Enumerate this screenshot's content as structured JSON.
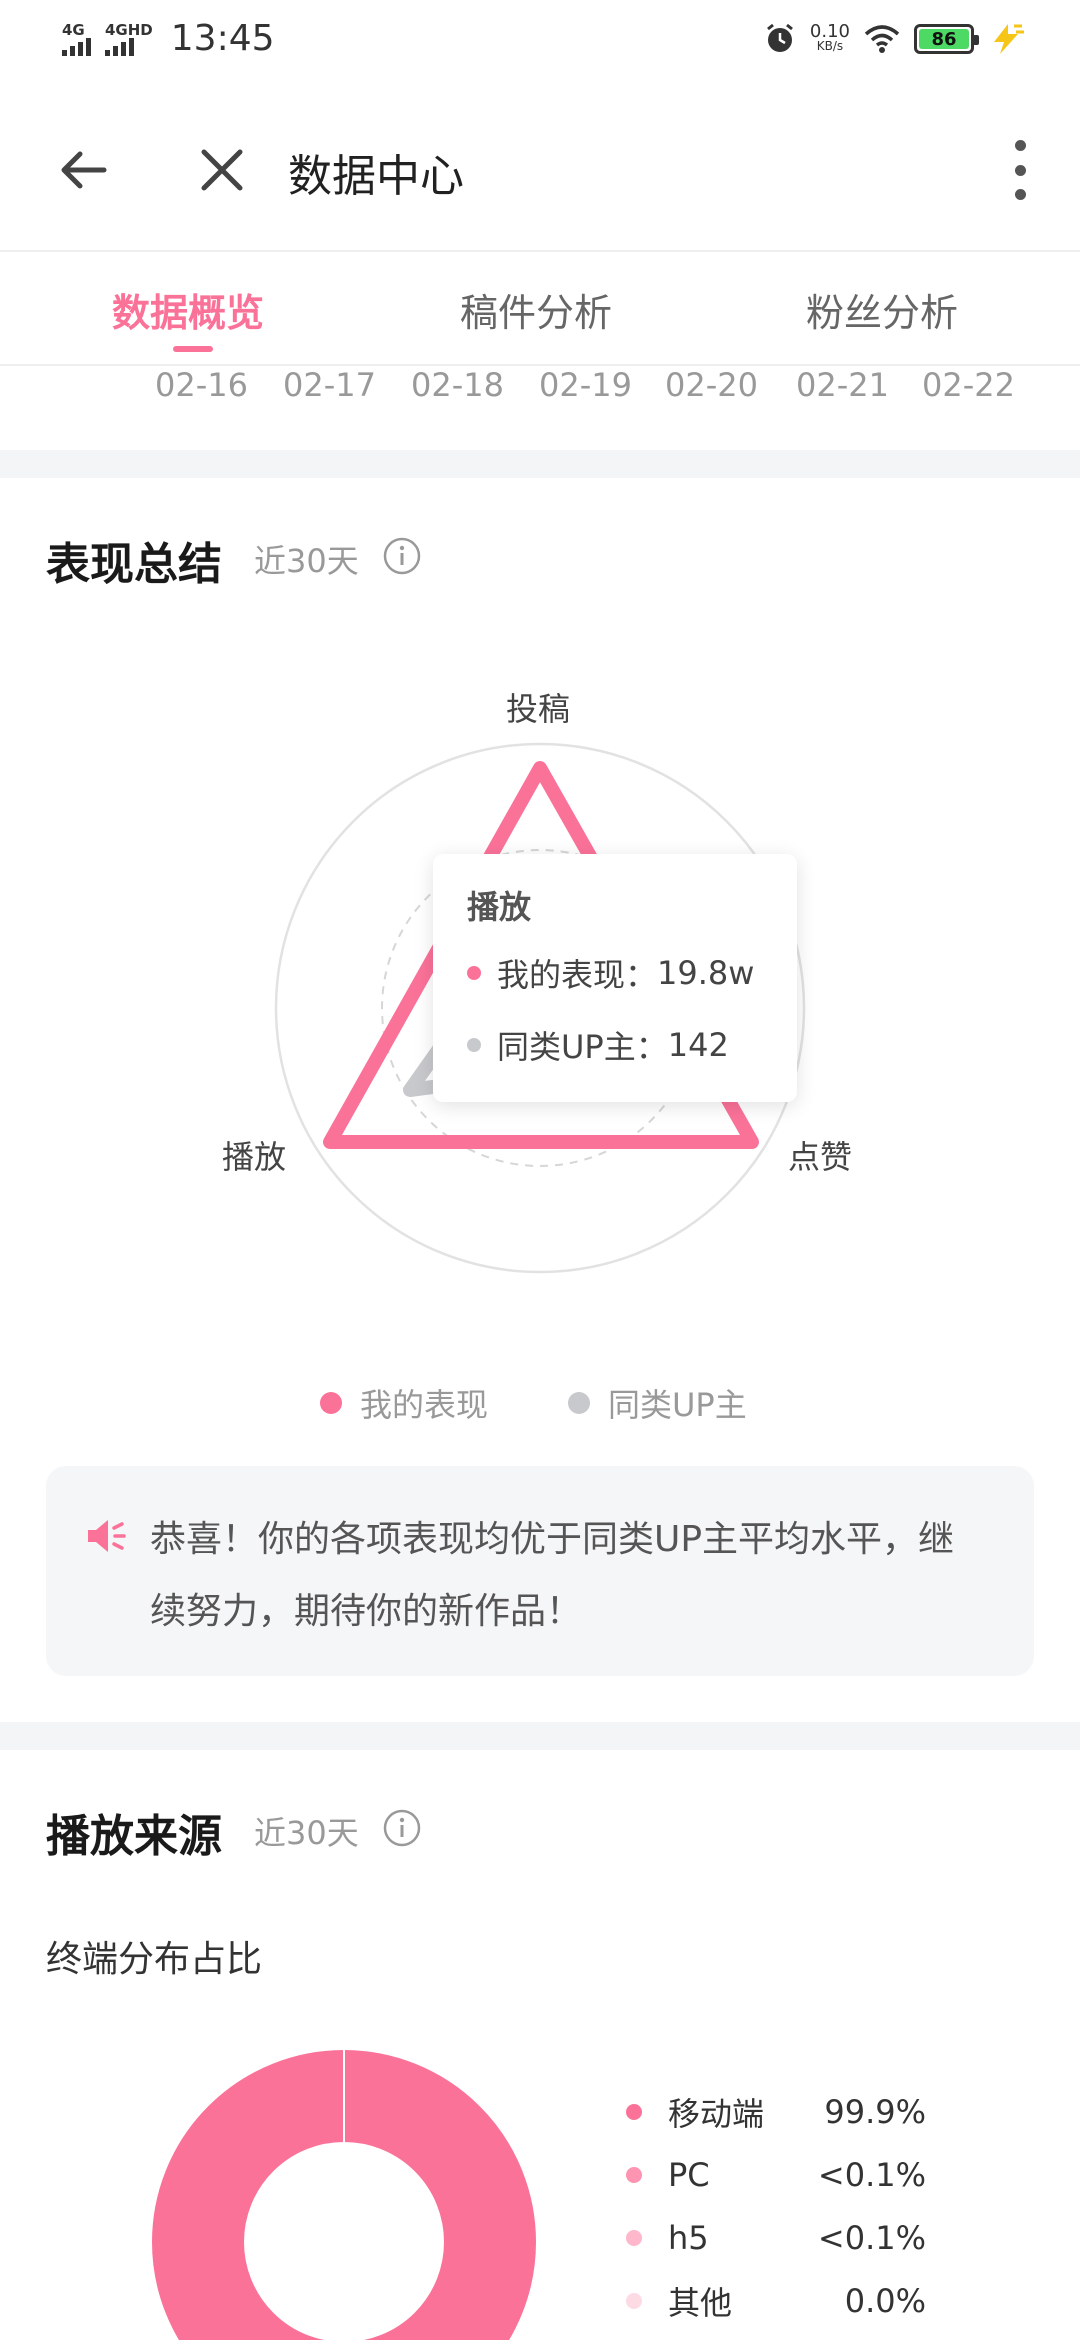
{
  "status_bar": {
    "signal1_label": "4G",
    "signal2_label": "4GHD",
    "time": "13:45",
    "speed_value": "0.10",
    "speed_unit": "KB/s",
    "battery_level": "86"
  },
  "app_bar": {
    "title": "数据中心"
  },
  "tabs": [
    {
      "label": "数据概览",
      "active": true
    },
    {
      "label": "稿件分析",
      "active": false
    },
    {
      "label": "粉丝分析",
      "active": false
    }
  ],
  "dates": [
    "02-16",
    "02-17",
    "02-18",
    "02-19",
    "02-20",
    "02-21",
    "02-22"
  ],
  "performance": {
    "title": "表现总结",
    "period": "近30天",
    "axes": {
      "top": "投稿",
      "left": "播放",
      "right": "点赞"
    },
    "tooltip": {
      "title": "播放",
      "mine_label": "我的表现：",
      "mine_value": "19.8w",
      "peer_label": "同类UP主：",
      "peer_value": "142"
    },
    "legend": {
      "mine": "我的表现",
      "peer": "同类UP主"
    },
    "notice": "恭喜！你的各项表现均优于同类UP主平均水平，继续努力，期待你的新作品！"
  },
  "play_source": {
    "title": "播放来源",
    "period": "近30天",
    "subtitle": "终端分布占比",
    "items": [
      {
        "name": "移动端",
        "value": "99.9%",
        "color": "#fb7299"
      },
      {
        "name": "PC",
        "value": "<0.1%",
        "color": "#fd94b1"
      },
      {
        "name": "h5",
        "value": "<0.1%",
        "color": "#feb7cb"
      },
      {
        "name": "其他",
        "value": "0.0%",
        "color": "#fddbe5"
      }
    ]
  },
  "colors": {
    "accent": "#fb7299",
    "peer": "#c8c9cc",
    "muted_text": "#999999"
  }
}
